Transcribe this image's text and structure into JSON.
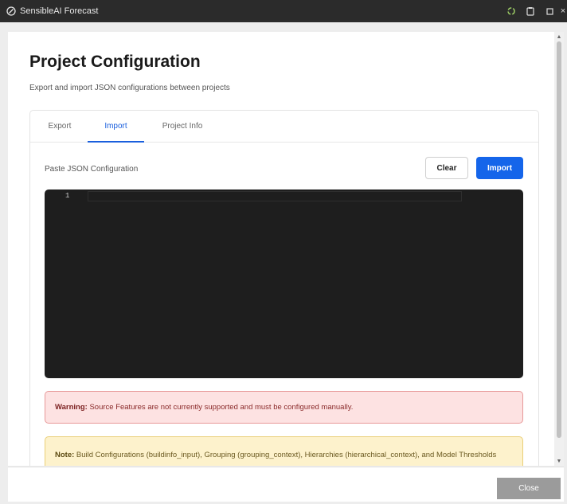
{
  "window": {
    "title": "SensibleAI Forecast"
  },
  "page": {
    "title": "Project Configuration",
    "subtitle": "Export and import JSON configurations between projects"
  },
  "tabs": [
    {
      "label": "Export",
      "active": false
    },
    {
      "label": "Import",
      "active": true
    },
    {
      "label": "Project Info",
      "active": false
    }
  ],
  "import_panel": {
    "paste_label": "Paste JSON Configuration",
    "clear_label": "Clear",
    "import_label": "Import",
    "editor": {
      "line_numbers": [
        "1"
      ],
      "content": ""
    }
  },
  "warning": {
    "prefix": "Warning:",
    "text": " Source Features are not currently supported and must be configured manually."
  },
  "note": {
    "prefix": "Note:",
    "text": " Build Configurations (buildinfo_input), Grouping (grouping_context), Hierarchies (hierarchical_context), and Model Thresholds (model_thresholds) were configured during Target Data Load and will not be imported. They are"
  },
  "footer": {
    "close_label": "Close"
  },
  "colors": {
    "accent": "#1565ea",
    "titlebar": "#2b2b2b",
    "editor_bg": "#1e1e1e",
    "warning_bg": "#fde2e2",
    "note_bg": "#fdf2cc"
  }
}
